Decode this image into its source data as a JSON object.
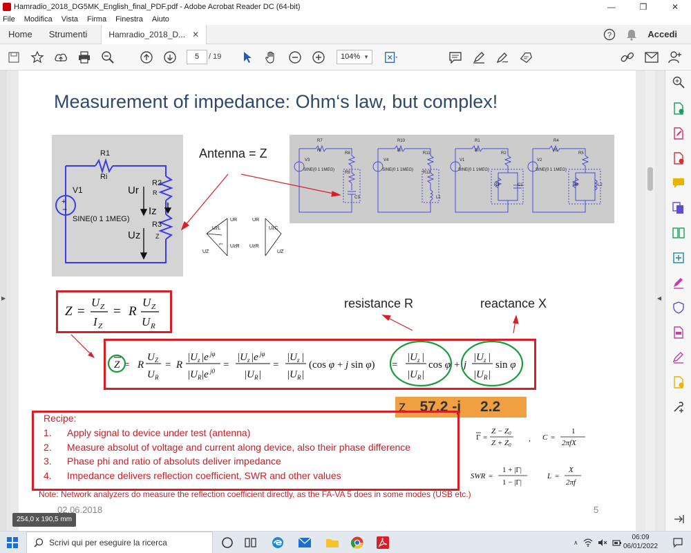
{
  "window": {
    "title": "Hamradio_2018_DG5MK_English_final_PDF.pdf - Adobe Acrobat Reader DC (64-bit)",
    "controls": [
      "—",
      "❒",
      "✕"
    ]
  },
  "menu": [
    "File",
    "Modifica",
    "Vista",
    "Firma",
    "Finestra",
    "Aiuto"
  ],
  "tabs": {
    "home": "Home",
    "tools": "Strumenti",
    "document": "Hamradio_2018_D...",
    "login": "Accedi"
  },
  "toolbar": {
    "page_current": "5",
    "page_total": "/ 19",
    "zoom": "104%"
  },
  "slide": {
    "title": "Measurement of impedance: Ohm‘s law, but complex!",
    "antenna_label": "Antenna = Z",
    "resistance_label": "resistance R",
    "reactance_label": "reactance X",
    "circuit1": {
      "r1": "R1",
      "ri": "Ri",
      "v1": "V1",
      "r2": "R2",
      "r3": "R3",
      "r_small": "R",
      "z_small": "Z",
      "ur": "Ur",
      "iz": "Iz",
      "uz": "Uz",
      "source": "SINE(0 1 1MEG)"
    },
    "phasor": {
      "ur": "UR",
      "uzl": "UzL",
      "uzr": "UzR",
      "uz": "UZ",
      "phi": "phi",
      "uzc": "UzC",
      "uz2": "UZ"
    },
    "circuits_right": [
      {
        "r_top": "R7",
        "ri": "Ri",
        "v": "V3",
        "source": "SINE(0 1 1MEG)",
        "r_a": "R8",
        "r_b": "R9",
        "c": "C3"
      },
      {
        "r_top": "R10",
        "ri": "Ri",
        "v": "V4",
        "source": "SINE(0 1 1MEG)",
        "r_a": "R11",
        "r_b": "R12",
        "l": "L1"
      },
      {
        "r_top": "R1",
        "ri": "Ri",
        "v": "V1",
        "source": "SINE(0 1 1MEG)",
        "r_a": "R2",
        "r_b": "R3",
        "c": "C1"
      },
      {
        "r_top": "R4",
        "ri": "Ri",
        "v": "V2",
        "source": "SINE(0 1 1MEG)",
        "r_a": "R5",
        "r_b": "R6",
        "l": "L2"
      }
    ],
    "z_result": {
      "z": "z",
      "value": "57.2 -j",
      "imag": "2.2"
    },
    "recipe": {
      "title": "Recipe:",
      "items": [
        {
          "num": "1.",
          "text": "Apply signal to device under test (antenna)"
        },
        {
          "num": "2.",
          "text": "Measure absolut of voltage and current along device, also their phase difference"
        },
        {
          "num": "3.",
          "text": "Phase phi and ratio of absoluts deliver impedance"
        },
        {
          "num": "4.",
          "text": "Impedance delivers reflection coefficient, SWR and other values"
        }
      ]
    },
    "note": "Note: Network analyzers do measure the reflection coefficient directly, as the FA-VA 5 does in some modes (USB etc.)",
    "date": "02.06.2018",
    "page_number": "5"
  },
  "dimension_badge": "254,0 x 190,5 mm",
  "taskbar": {
    "search_placeholder": "Scrivi qui per eseguire la ricerca",
    "time": "06:09",
    "date": "06/01/2022"
  },
  "colors": {
    "accent_red": "#d81f26",
    "title_blue": "#2e4a6b",
    "result_orange": "#f0a040",
    "green_circle": "#1a9a3a"
  }
}
